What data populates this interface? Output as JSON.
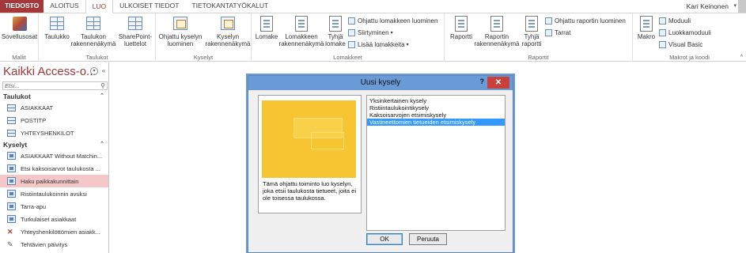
{
  "tabs": {
    "file": "TIEDOSTO",
    "home": "ALOITUS",
    "create": "LUO",
    "external": "ULKOISET TIEDOT",
    "dbtools": "TIETOKANTATYÖKALUT"
  },
  "user": {
    "name": "Kari Keinonen"
  },
  "ribbon": {
    "templates": {
      "btn": "Sovellusosat",
      "label": "Mallit"
    },
    "tables": {
      "table": "Taulukko",
      "design": "Taulukon rakennenäkymä",
      "sharepoint": "SharePoint-luettelot",
      "label": "Taulukot"
    },
    "queries": {
      "wizard": "Ohjattu kyselyn luominen",
      "design": "Kyselyn rakennenäkymä",
      "label": "Kyselyt"
    },
    "forms": {
      "form": "Lomake",
      "design": "Lomakkeen rakennenäkymä",
      "blank": "Tyhjä lomake",
      "wizard": "Ohjattu lomakkeen luominen",
      "navigation": "Siirtyminen",
      "more": "Lisää lomakkeita",
      "label": "Lomakkeet"
    },
    "reports": {
      "report": "Raportti",
      "design": "Raportin rakennenäkymä",
      "blank": "Tyhjä raportti",
      "wizard": "Ohjattu raportin luominen",
      "labels": "Tarrat",
      "label": "Raportit"
    },
    "macros": {
      "macro": "Makro",
      "module": "Moduuli",
      "classmodule": "Luokkamoduuli",
      "vb": "Visual Basic",
      "label": "Makrot ja koodi"
    }
  },
  "nav": {
    "title": "Kaikki Access-o...",
    "search_placeholder": "Etsi...",
    "tables_header": "Taulukot",
    "tables": [
      "ASIAKKAAT",
      "POSTITP",
      "YHTEYSHENKILOT"
    ],
    "queries_header": "Kyselyt",
    "queries": [
      "ASIAKKAAT Without Matchin...",
      "Etsi kaksoisarvot taulukosta ...",
      "Haku paikkakunnittain",
      "Ristiintaulukoinnin avuksi",
      "Tarra-apu",
      "Turkulaiset asiakkaat",
      "Yhteyshenkilöttömien asiakk...",
      "Tehtävien päivitys"
    ]
  },
  "dialog": {
    "title": "Uusi kysely",
    "help": "?",
    "close": "✕",
    "description": "Tämä ohjattu toiminto luo kyselyn, joka etsii taulukosta tietueet, joita ei ole toisessa taulukossa.",
    "options": [
      "Yksinkertainen kysely",
      "Ristiintaulukointikysely",
      "Kaksoisarvojen etsimiskysely",
      "Vastineettomien tietueiden etsimiskysely"
    ],
    "selected_index": 3,
    "ok": "OK",
    "cancel": "Peruuta"
  },
  "colors": {
    "accent": "#a4373a",
    "dialog_title": "#6b9bd6",
    "selection": "#3399ff",
    "nav_selected": "#f5c7c8"
  }
}
